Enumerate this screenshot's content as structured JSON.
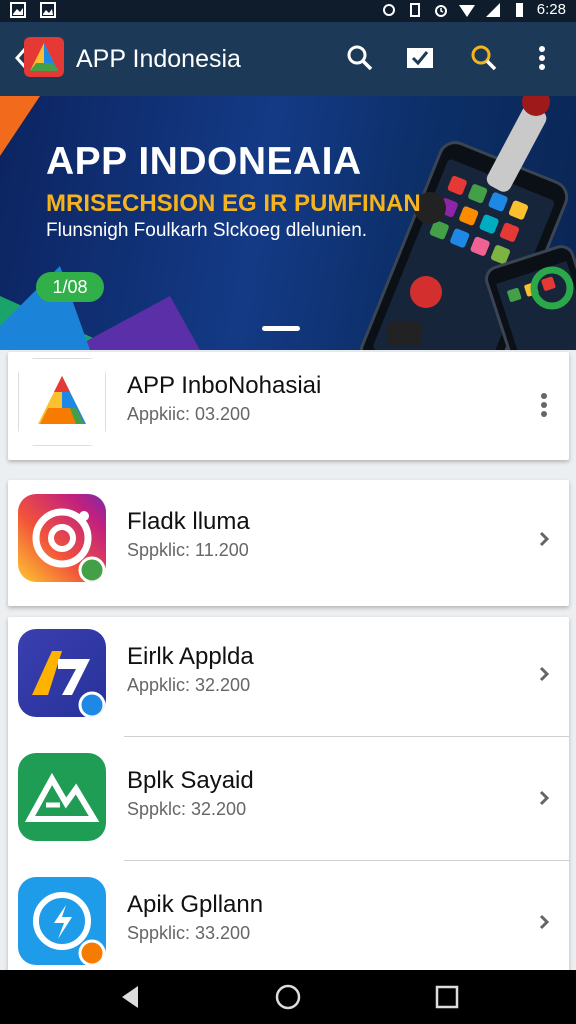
{
  "status": {
    "time": "6:28"
  },
  "toolbar": {
    "title": "APP Indonesia"
  },
  "banner": {
    "title": "APP INDONEAIA",
    "subtitle": "MRISECHSION EG IR PUMFINAN",
    "caption": "Flunsnigh Foulkarh Slckoeg dlelunien.",
    "badge": "1/08"
  },
  "apps": [
    {
      "name": "APP InboNohasiai",
      "size": "Appkiic: 03.200"
    },
    {
      "name": "Fladk lluma",
      "size": "Sppklic: 11.200"
    },
    {
      "name": "Eirlk Applda",
      "size": "Appklic: 32.200"
    },
    {
      "name": "Bplk Sayaid",
      "size": "Sppklc: 32.200"
    },
    {
      "name": "Apik Gpllann",
      "size": "Sppklic: 33.200"
    }
  ],
  "icons": {
    "back": "chevron-left-icon",
    "search": "search-icon",
    "edit": "edit-check-icon",
    "search2": "search-icon",
    "more": "more-vert-icon"
  },
  "colors": {
    "appbar": "#1c3a57",
    "banner": "#143a86",
    "accent": "#f6b31c",
    "badge": "#31b04a"
  }
}
